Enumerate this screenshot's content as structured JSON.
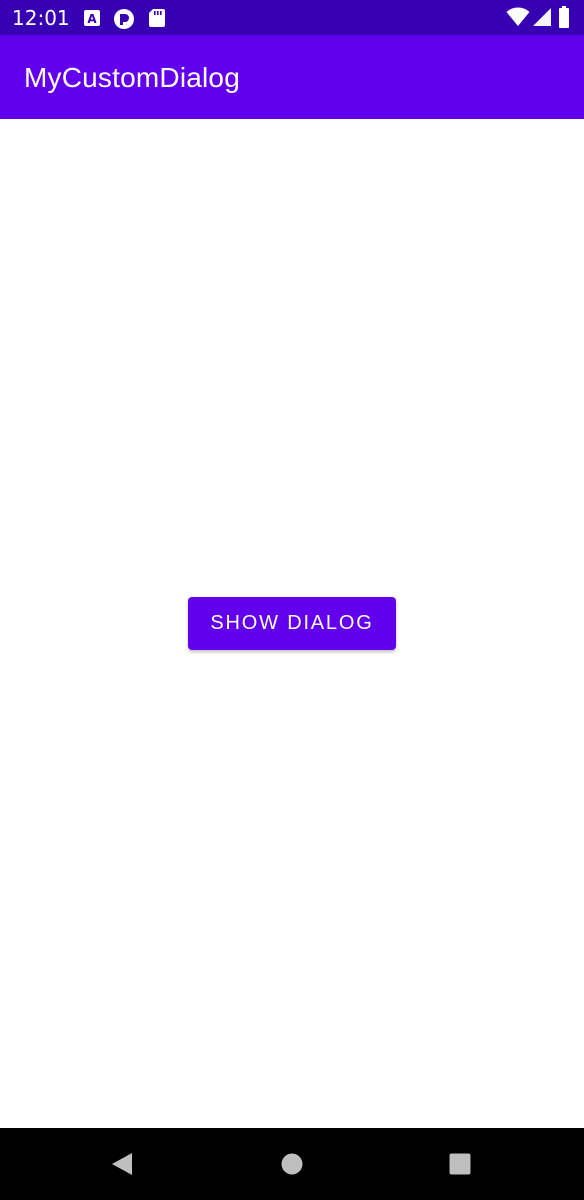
{
  "status_bar": {
    "time": "12:01",
    "icons": [
      "text-a-icon",
      "notification-p-icon",
      "sd-card-icon",
      "wifi-icon",
      "cellular-signal-icon",
      "battery-icon"
    ],
    "background": "#3700B3"
  },
  "app_bar": {
    "title": "MyCustomDialog",
    "background": "#6200EE"
  },
  "main": {
    "show_dialog_label": "SHOW DIALOG",
    "button_color": "#6200EE"
  },
  "nav_bar": {
    "icons": [
      "back-icon",
      "home-icon",
      "recents-icon"
    ],
    "background": "#000000"
  }
}
